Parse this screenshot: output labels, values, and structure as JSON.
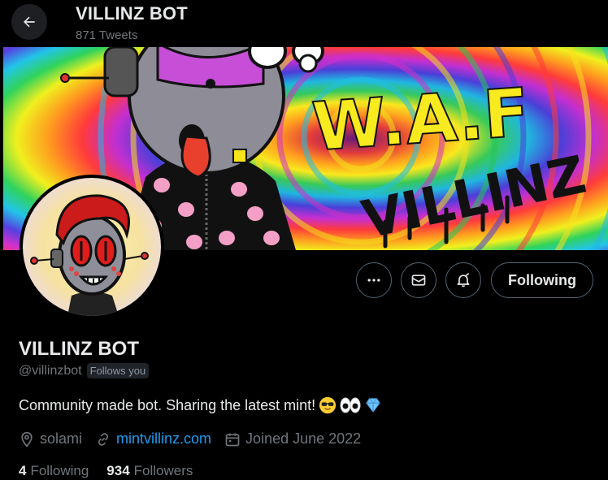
{
  "header": {
    "title": "VILLINZ BOT",
    "tweet_count": "871 Tweets"
  },
  "banner": {
    "text_main": "W.A.F",
    "text_tag": "VILLINZ"
  },
  "actions": {
    "follow_label": "Following",
    "more_icon": "more-icon",
    "message_icon": "mail-icon",
    "notify_icon": "bell-icon"
  },
  "profile": {
    "name": "VILLINZ BOT",
    "handle": "@villinzbot",
    "follows_you": "Follows you",
    "bio": "Community made bot. Sharing the latest mint!",
    "bio_emojis": [
      "sunglasses-emoji",
      "eyes-emoji",
      "diamond-emoji"
    ],
    "location": "solami",
    "website": "mintvillinz.com",
    "joined": "Joined June 2022"
  },
  "stats": {
    "following_count": "4",
    "following_label": "Following",
    "followers_count": "934",
    "followers_label": "Followers"
  },
  "colors": {
    "background": "#000000",
    "text": "#e7e9ea",
    "muted": "#71767b",
    "link": "#1d9bf0",
    "border": "#536471"
  }
}
